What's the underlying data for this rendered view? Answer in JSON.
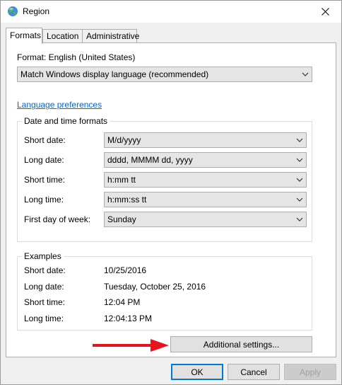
{
  "window": {
    "title": "Region"
  },
  "tabs": [
    {
      "label": "Formats",
      "active": true
    },
    {
      "label": "Location",
      "active": false
    },
    {
      "label": "Administrative",
      "active": false
    }
  ],
  "format": {
    "label": "Format: English (United States)",
    "value": "Match Windows display language (recommended)"
  },
  "language_link": "Language preferences",
  "date_time": {
    "group_title": "Date and time formats",
    "rows": [
      {
        "label": "Short date:",
        "value": "M/d/yyyy"
      },
      {
        "label": "Long date:",
        "value": "dddd, MMMM dd, yyyy"
      },
      {
        "label": "Short time:",
        "value": "h:mm tt"
      },
      {
        "label": "Long time:",
        "value": "h:mm:ss tt"
      },
      {
        "label": "First day of week:",
        "value": "Sunday"
      }
    ]
  },
  "examples": {
    "group_title": "Examples",
    "rows": [
      {
        "label": "Short date:",
        "value": "10/25/2016"
      },
      {
        "label": "Long date:",
        "value": "Tuesday, October 25, 2016"
      },
      {
        "label": "Short time:",
        "value": "12:04 PM"
      },
      {
        "label": "Long time:",
        "value": "12:04:13 PM"
      }
    ]
  },
  "buttons": {
    "additional": "Additional settings...",
    "ok": "OK",
    "cancel": "Cancel",
    "apply": "Apply"
  },
  "icons": {
    "title": "globe-icon",
    "close": "close-icon",
    "dropdown": "chevron-down-icon",
    "annotation": "red-arrow-icon"
  },
  "colors": {
    "link": "#0066cc",
    "default_button_border": "#0078d7",
    "annotation_arrow": "#e8141b"
  }
}
